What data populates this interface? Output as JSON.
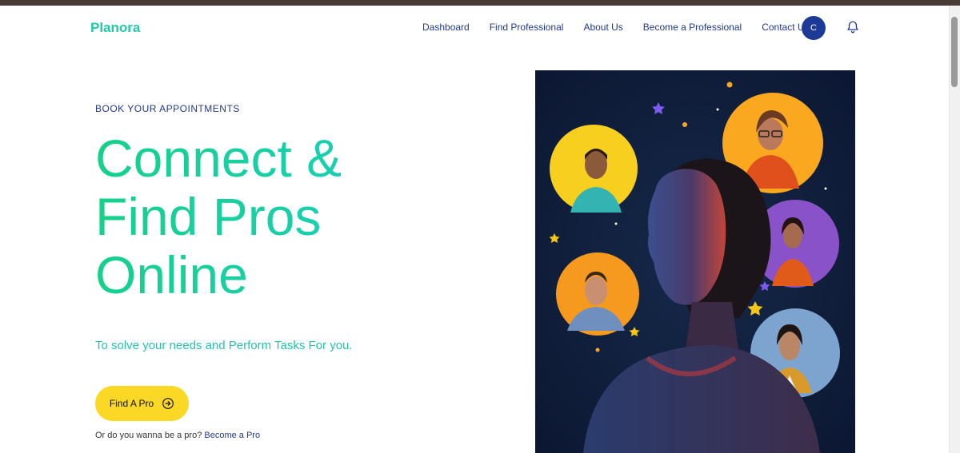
{
  "brand": {
    "name": "Planora"
  },
  "nav": {
    "items": [
      {
        "label": "Dashboard"
      },
      {
        "label": "Find Professional"
      },
      {
        "label": "About Us"
      },
      {
        "label": "Become a Professional"
      },
      {
        "label": "Contact Us"
      }
    ],
    "avatar_initial": "C"
  },
  "hero": {
    "eyebrow": "BOOK YOUR APPOINTMENTS",
    "headline_lines": [
      "Connect &",
      "Find Pros",
      "Online"
    ],
    "subtext": "To solve your needs and Perform Tasks For you.",
    "cta_label": "Find A Pro",
    "become_prefix": "Or do you wanna be a pro?",
    "become_link": "Become a Pro"
  },
  "colors": {
    "brand": "#22c9a5",
    "nav_text": "#1f3a8a",
    "cta_bg": "#fad825",
    "hero_bg": "#0f1e3a"
  },
  "icons": [
    "bell-icon",
    "arrow-circle-right-icon"
  ]
}
